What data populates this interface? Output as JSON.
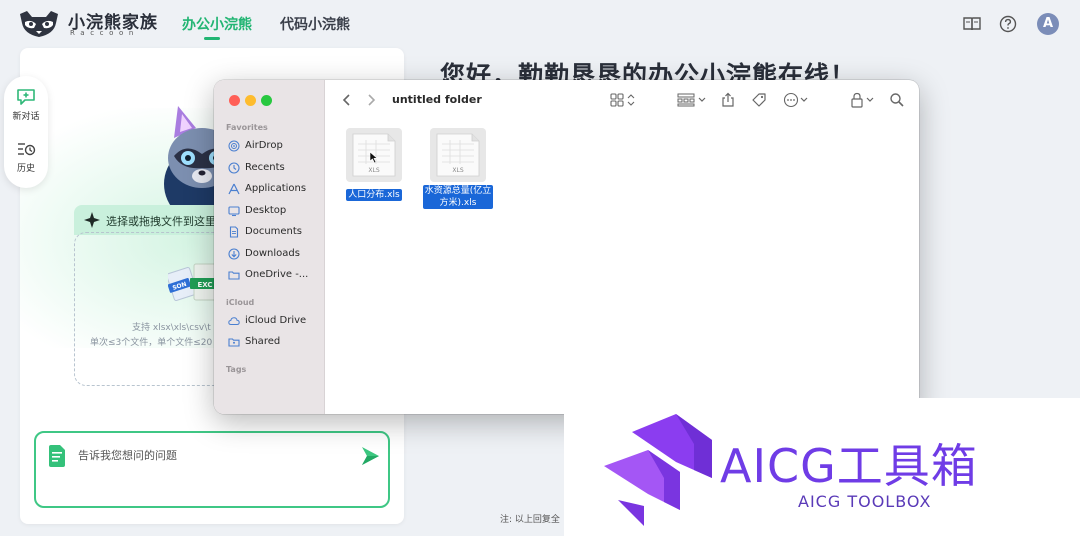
{
  "app": {
    "name": "小浣熊家族",
    "subtitle": "Raccoon",
    "tabs": [
      {
        "label": "办公小浣熊",
        "active": true
      },
      {
        "label": "代码小浣熊",
        "active": false
      }
    ],
    "avatar_letter": "A",
    "accent_color": "#22b573"
  },
  "side_rail": {
    "items": [
      {
        "label": "新对话",
        "icon": "new-chat-icon"
      },
      {
        "label": "历史",
        "icon": "history-icon"
      }
    ]
  },
  "greeting": "您好，勤勤恳恳的办公小浣熊在线！",
  "upload": {
    "banner": "选择或拖拽文件到这里",
    "support": "支持 xlsx\\xls\\csv\\t",
    "limit": "单次≤3个文件，单个文件≤20"
  },
  "chat": {
    "placeholder": "告诉我您想问的问题"
  },
  "footnote": "注: 以上回复全",
  "finder": {
    "folder_title": "untitled folder",
    "sections": {
      "favorites": "Favorites",
      "icloud": "iCloud",
      "tags": "Tags"
    },
    "favorites": [
      {
        "label": "AirDrop",
        "icon": "airdrop-icon"
      },
      {
        "label": "Recents",
        "icon": "clock-icon"
      },
      {
        "label": "Applications",
        "icon": "applications-icon"
      },
      {
        "label": "Desktop",
        "icon": "desktop-icon"
      },
      {
        "label": "Documents",
        "icon": "document-icon"
      },
      {
        "label": "Downloads",
        "icon": "download-icon"
      },
      {
        "label": "OneDrive -...",
        "icon": "folder-icon"
      }
    ],
    "icloud": [
      {
        "label": "iCloud Drive",
        "icon": "cloud-icon"
      },
      {
        "label": "Shared",
        "icon": "shared-folder-icon"
      }
    ],
    "files": [
      {
        "name": "人口分布.xls",
        "type": "XLS"
      },
      {
        "name_line1": "水资源总量(亿立",
        "name_line2": "方米).xls",
        "type": "XLS"
      }
    ]
  },
  "watermark": {
    "title": "AICG工具箱",
    "subtitle": "AICG TOOLBOX",
    "color": "#6f3ce6"
  }
}
